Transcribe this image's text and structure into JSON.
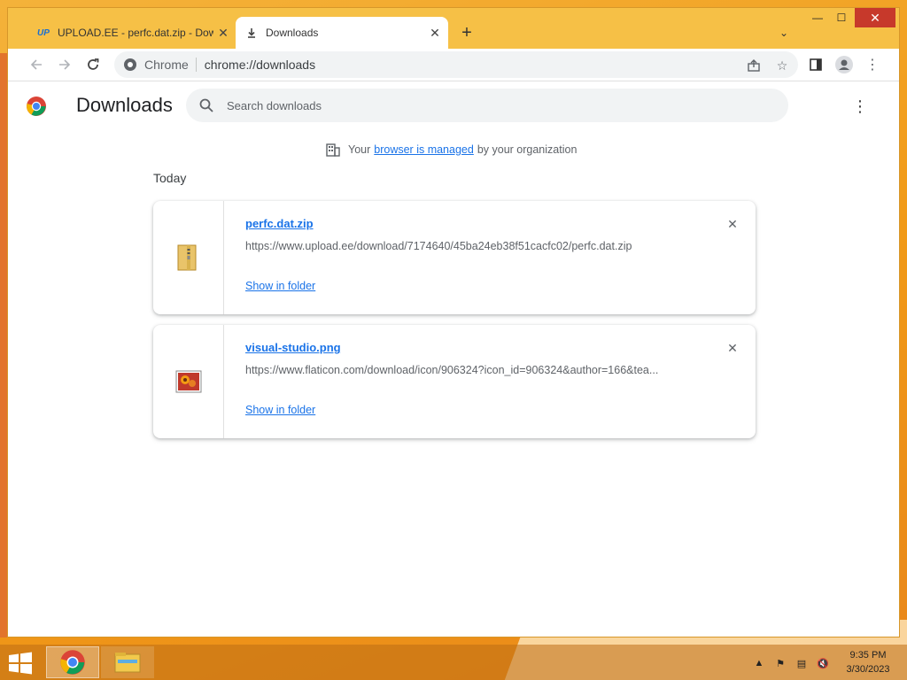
{
  "browser": {
    "tabs": [
      {
        "title": "UPLOAD.EE - perfc.dat.zip - Dow",
        "favicon": "upload-ee-logo",
        "favicon_text": "UP",
        "active": false
      },
      {
        "title": "Downloads",
        "favicon": "download-icon",
        "active": true
      }
    ],
    "omnibox": {
      "chip": "Chrome",
      "url": "chrome://downloads"
    }
  },
  "page": {
    "title": "Downloads",
    "search_placeholder": "Search downloads",
    "managed": {
      "prefix": "Your",
      "link": "browser is managed",
      "suffix": "by your organization"
    },
    "section_label": "Today",
    "downloads": [
      {
        "name": "perfc.dat.zip",
        "url": "https://www.upload.ee/download/7174640/45ba24eb38f51cacfc02/perfc.dat.zip",
        "action": "Show in folder",
        "icon": "zip-folder-icon"
      },
      {
        "name": "visual-studio.png",
        "url": "https://www.flaticon.com/download/icon/906324?icon_id=906324&author=166&tea...",
        "action": "Show in folder",
        "icon": "image-file-icon"
      }
    ]
  },
  "taskbar": {
    "time": "9:35 PM",
    "date": "3/30/2023"
  },
  "colors": {
    "accent": "#1a73e8",
    "window_frame": "#f6c046",
    "close_button": "#c7392b"
  }
}
